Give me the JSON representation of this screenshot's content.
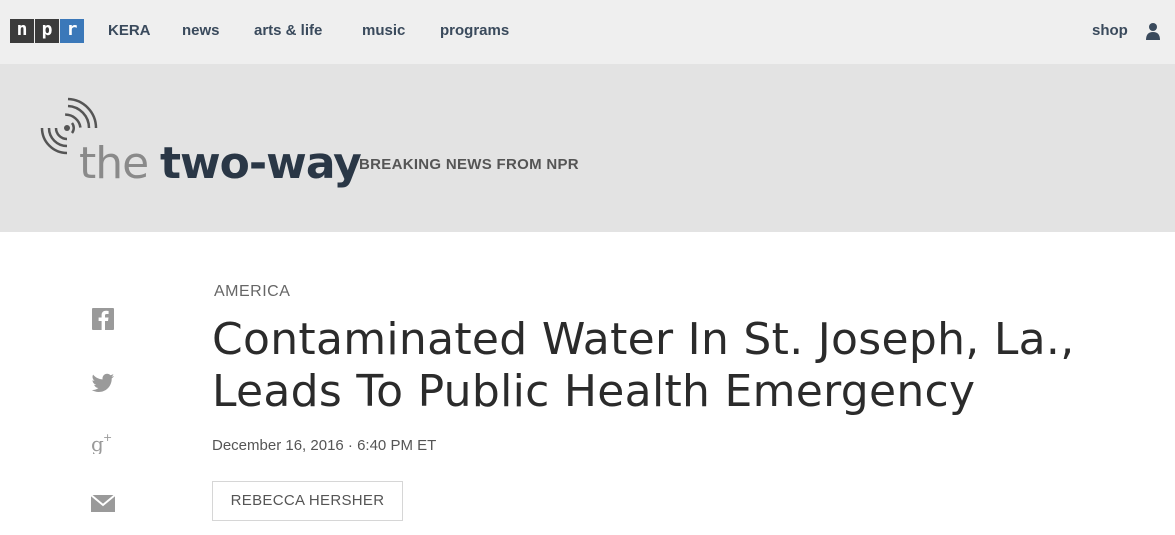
{
  "topnav": {
    "logo_letters": [
      "n",
      "p",
      "r"
    ],
    "items": [
      "KERA",
      "news",
      "arts & life",
      "music",
      "programs"
    ],
    "shop_label": "shop",
    "user_icon": "user-icon"
  },
  "blog": {
    "name_the": "the",
    "name_twoway": "two-way",
    "tagline": "BREAKING NEWS FROM NPR",
    "logo_icon": "signal-icon"
  },
  "share": {
    "icons": [
      "facebook-icon",
      "twitter-icon",
      "google-plus-icon",
      "email-icon"
    ]
  },
  "article": {
    "slug": "AMERICA",
    "headline_line1": "Contaminated Water In St. Joseph, La.,",
    "headline_line2": "Leads To Public Health Emergency",
    "dateline": "December 16, 2016 · 6:40 PM ET",
    "byline": "REBECCA HERSHER"
  },
  "colors": {
    "nav_bg": "#efefef",
    "banner_bg": "#e3e3e3",
    "npr_blue": "#3b78b9",
    "nav_text": "#3a4a5c"
  }
}
